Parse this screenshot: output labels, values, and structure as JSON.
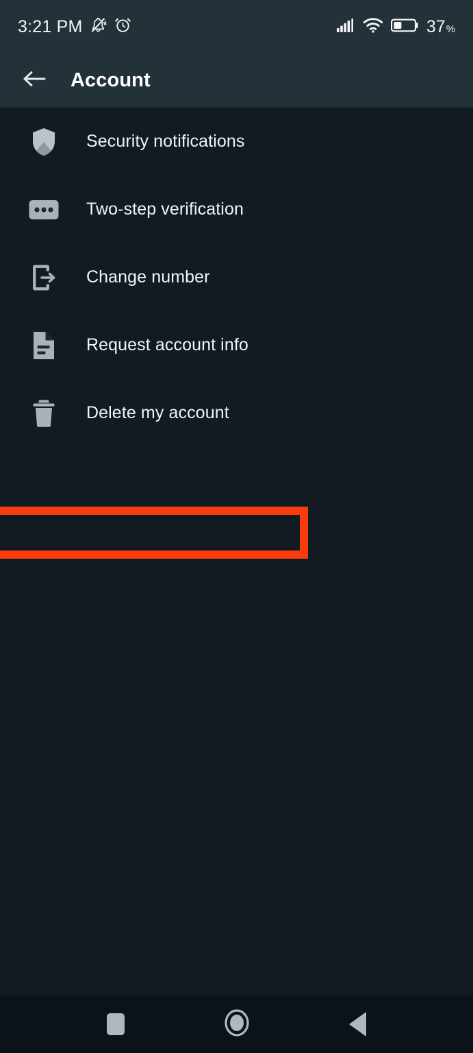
{
  "status_bar": {
    "time": "3:21 PM",
    "icons": [
      "bell-muted-icon",
      "alarm-clock-icon"
    ],
    "signal_icon": "cellular-signal-icon",
    "wifi_icon": "wifi-icon",
    "battery_icon": "battery-icon",
    "battery_level": "37",
    "battery_unit": "%"
  },
  "app_bar": {
    "back_icon": "back-arrow-icon",
    "title": "Account"
  },
  "list": {
    "items": [
      {
        "label": "Security notifications",
        "icon": "shield-icon"
      },
      {
        "label": "Two-step verification",
        "icon": "passcode-dots-icon"
      },
      {
        "label": "Change number",
        "icon": "phone-exit-arrow-icon"
      },
      {
        "label": "Request account info",
        "icon": "document-icon"
      },
      {
        "label": "Delete my account",
        "icon": "trash-icon"
      }
    ]
  },
  "highlight": {
    "target_label": "Delete my account",
    "color": "#f93c0c"
  },
  "nav_bar": {
    "recents_icon": "square-recents-icon",
    "home_icon": "circle-home-icon",
    "back_icon": "triangle-back-icon"
  },
  "colors": {
    "app_bar_bg": "#233138",
    "body_bg": "#121b22",
    "nav_bg": "#0c121a",
    "icon_tint": "#8d9aa3",
    "text_primary": "#f2f4f5",
    "highlight": "#f93c0c"
  }
}
